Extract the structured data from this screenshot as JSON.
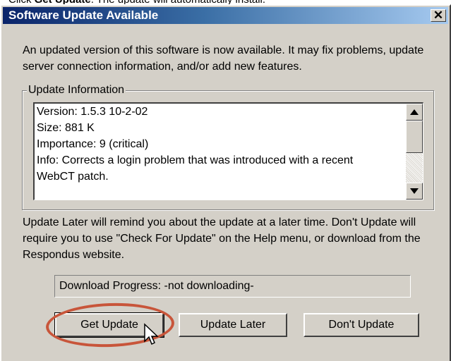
{
  "instruction": {
    "prefix": "Click ",
    "bold": "Get Update",
    "suffix": ". The update will automatically install."
  },
  "dialog": {
    "title": "Software Update Available",
    "close_glyph": "✕",
    "intro": "An updated version of this software is now available.  It may fix problems, update server connection information, and/or add new features.",
    "group_label": "Update Information",
    "info_lines": [
      "Version: 1.5.3  10-2-02",
      "Size: 881 K",
      "Importance: 9 (critical)",
      "Info: Corrects a login problem that was introduced with a recent",
      "WebCT patch."
    ],
    "later_text": "Update Later will remind you about the update at a later time.  Don't Update will require you to use \"Check For Update\" on the Help menu, or download from the Respondus website.",
    "progress_text": "Download Progress:  -not downloading-",
    "buttons": {
      "get_update": "Get Update",
      "update_later": "Update Later",
      "dont_update": "Don't Update"
    },
    "icons": [
      "close-icon",
      "scroll-up-arrow-icon",
      "scroll-down-arrow-icon",
      "mouse-pointer-icon"
    ],
    "highlight_color": "#c8553a"
  }
}
